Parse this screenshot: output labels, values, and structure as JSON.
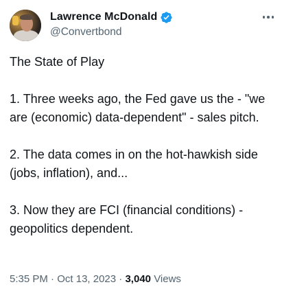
{
  "author": {
    "display_name": "Lawrence McDonald",
    "handle": "@Convertbond",
    "verified": true,
    "verified_color": "#1d9bf0"
  },
  "tweet": {
    "paragraphs": [
      "The State of Play",
      "1.  Three weeks ago, the Fed gave us the - \"we are (economic) data-dependent\" - sales pitch.",
      "2. The data comes in on the hot-hawkish side (jobs, inflation), and...",
      "3. Now they are FCI (financial conditions) - geopolitics dependent."
    ]
  },
  "meta": {
    "time": "5:35 PM",
    "separator": "·",
    "date": "Oct 13, 2023",
    "views_count": "3,040",
    "views_label": "Views"
  },
  "icons": {
    "more": "more-horizontal-icon",
    "verified": "verified-badge-icon"
  }
}
